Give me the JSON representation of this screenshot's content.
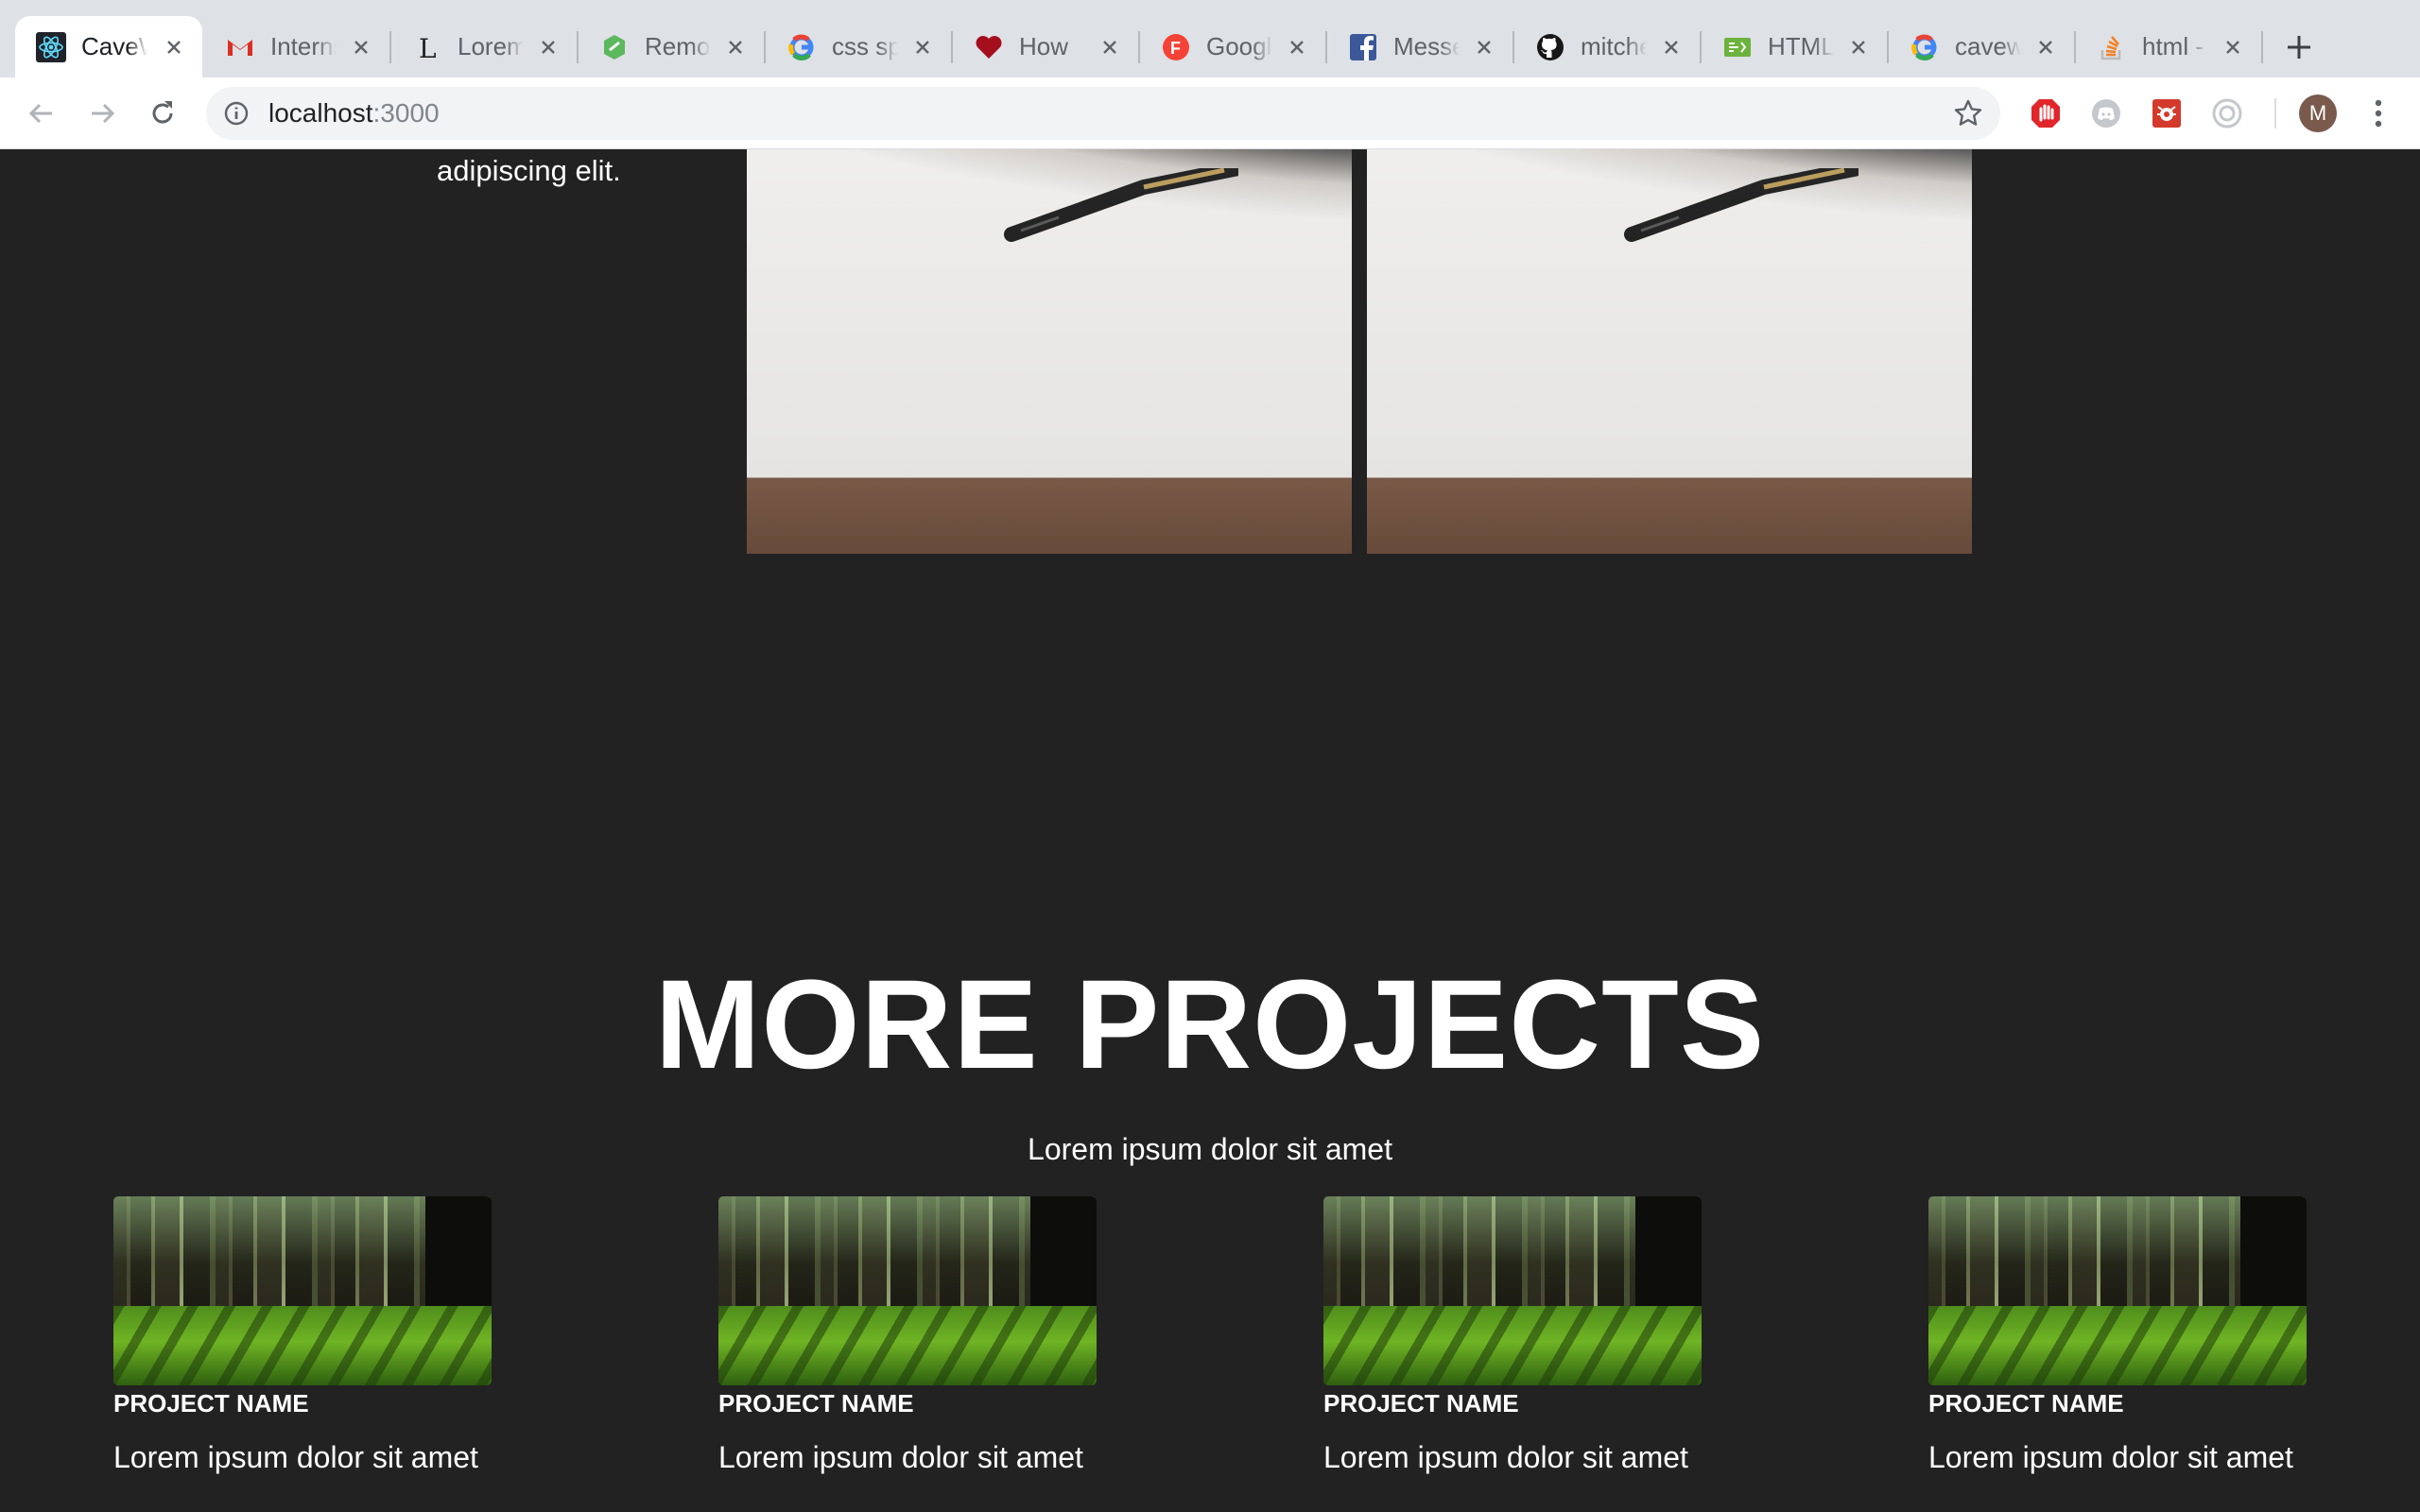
{
  "browser": {
    "tabs": [
      {
        "title": "CaveWorks",
        "icon": "react-icon",
        "active": true
      },
      {
        "title": "Internship",
        "icon": "gmail-icon",
        "active": false
      },
      {
        "title": "Lorem Ipsum",
        "icon": "lorem-l-icon",
        "active": false
      },
      {
        "title": "Remove",
        "icon": "removebg-icon",
        "active": false
      },
      {
        "title": "css sprites",
        "icon": "google-icon",
        "active": false
      },
      {
        "title": "How",
        "icon": "heart-icon",
        "active": false
      },
      {
        "title": "Google Fonts",
        "icon": "google-fonts-icon",
        "active": false
      },
      {
        "title": "Messenger",
        "icon": "facebook-icon",
        "active": false
      },
      {
        "title": "mitchell",
        "icon": "github-icon",
        "active": false
      },
      {
        "title": "HTML",
        "icon": "html-icon",
        "active": false
      },
      {
        "title": "caveworks",
        "icon": "google-icon",
        "active": false
      },
      {
        "title": "html - ",
        "icon": "stackoverflow-icon",
        "active": false
      }
    ],
    "url_host": "localhost",
    "url_port": ":3000",
    "avatar_letter": "M"
  },
  "page": {
    "side_text": "amet, consectetur adipiscing elit.",
    "section_title": "MORE PROJECTS",
    "section_subtitle": "Lorem ipsum dolor sit amet",
    "projects": [
      {
        "name": "PROJECT NAME",
        "description": "Lorem ipsum dolor sit amet"
      },
      {
        "name": "PROJECT NAME",
        "description": "Lorem ipsum dolor sit amet"
      },
      {
        "name": "PROJECT NAME",
        "description": "Lorem ipsum dolor sit amet"
      },
      {
        "name": "PROJECT NAME",
        "description": "Lorem ipsum dolor sit amet"
      }
    ]
  },
  "colors": {
    "page_background": "#222222",
    "tabstrip": "#dee1e6",
    "text": "#ffffff"
  }
}
